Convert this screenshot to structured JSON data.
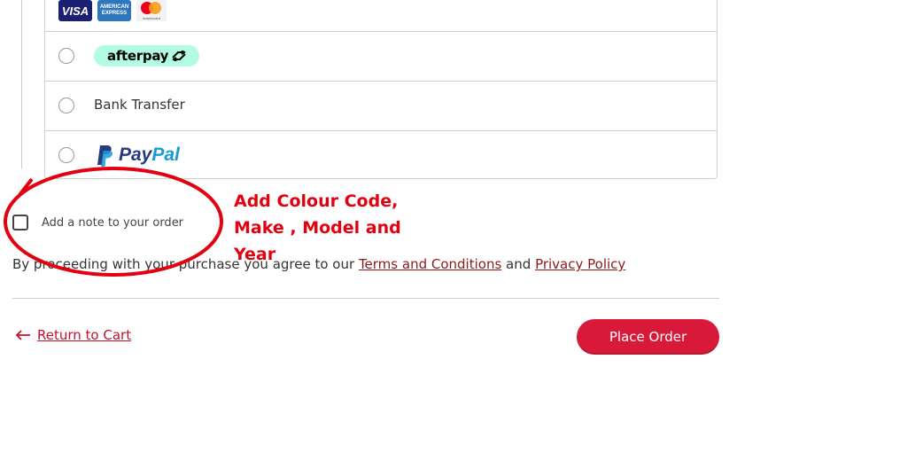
{
  "payment_methods": {
    "cards": [
      {
        "icon": "visa-card-icon",
        "label": "VISA"
      },
      {
        "icon": "amex-card-icon",
        "label": "AMERICAN EXPRESS"
      },
      {
        "icon": "mastercard-card-icon",
        "label": "mastercard"
      }
    ],
    "afterpay": {
      "label": "afterpay"
    },
    "bank_transfer": {
      "label": "Bank Transfer"
    },
    "paypal": {
      "label_pay": "Pay",
      "label_pal": "Pal"
    }
  },
  "note": {
    "label": "Add a note to your order",
    "checked": false
  },
  "agreement": {
    "prefix": "By proceeding with your purchase you agree to our",
    "terms_link": "Terms and Conditions",
    "conjunction": "and",
    "privacy_link": "Privacy Policy"
  },
  "footer": {
    "return_label": "Return to Cart",
    "place_order_label": "Place Order"
  },
  "annotation": {
    "lines": [
      "Add Colour Code,",
      "Make , Model and",
      "Year"
    ],
    "color": "#e3000f"
  },
  "colors": {
    "accent": "#d8193a",
    "link": "#8b1a1a",
    "afterpay_bg": "#b2fce4"
  }
}
